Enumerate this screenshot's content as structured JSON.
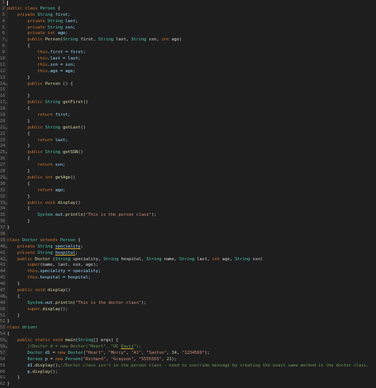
{
  "editor": {
    "lines": [
      [
        {
          "t": "",
          "c": "pl"
        }
      ],
      [
        {
          "t": "public class ",
          "c": "kw"
        },
        {
          "t": "Person",
          "c": "cls"
        },
        {
          "t": " {",
          "c": "pl"
        }
      ],
      [
        {
          "t": "    private ",
          "c": "kw"
        },
        {
          "t": "String ",
          "c": "cls"
        },
        {
          "t": "first;",
          "c": "fld"
        }
      ],
      [
        {
          "t": "        private ",
          "c": "kw"
        },
        {
          "t": "String ",
          "c": "cls"
        },
        {
          "t": "last;",
          "c": "fld"
        }
      ],
      [
        {
          "t": "        private ",
          "c": "kw"
        },
        {
          "t": "String ",
          "c": "cls"
        },
        {
          "t": "ssn;",
          "c": "fld"
        }
      ],
      [
        {
          "t": "        private ",
          "c": "kw"
        },
        {
          "t": "int ",
          "c": "kw"
        },
        {
          "t": "age;",
          "c": "fld"
        }
      ],
      [
        {
          "t": "        public ",
          "c": "kw"
        },
        {
          "t": "Person",
          "c": "mth"
        },
        {
          "t": "(",
          "c": "pl"
        },
        {
          "t": "String ",
          "c": "cls"
        },
        {
          "t": "first, ",
          "c": "pl"
        },
        {
          "t": "String ",
          "c": "cls"
        },
        {
          "t": "last, ",
          "c": "pl"
        },
        {
          "t": "String ",
          "c": "cls"
        },
        {
          "t": "ssn, ",
          "c": "pl"
        },
        {
          "t": "int ",
          "c": "kw"
        },
        {
          "t": "age)",
          "c": "pl"
        }
      ],
      [
        {
          "t": "        {",
          "c": "pl"
        }
      ],
      [
        {
          "t": "            this",
          "c": "kw"
        },
        {
          "t": ".first = first;",
          "c": "fld"
        }
      ],
      [
        {
          "t": "            this",
          "c": "kw"
        },
        {
          "t": ".last = last;",
          "c": "fld"
        }
      ],
      [
        {
          "t": "            this",
          "c": "kw"
        },
        {
          "t": ".ssn = ssn;",
          "c": "fld"
        }
      ],
      [
        {
          "t": "            this",
          "c": "kw"
        },
        {
          "t": ".age = age;",
          "c": "fld"
        }
      ],
      [
        {
          "t": "        }",
          "c": "pl"
        }
      ],
      [
        {
          "t": "        public ",
          "c": "kw"
        },
        {
          "t": "Person",
          "c": "mth"
        },
        {
          "t": " () {",
          "c": "pl"
        }
      ],
      [
        {
          "t": "",
          "c": "pl"
        }
      ],
      [
        {
          "t": "        }",
          "c": "pl"
        }
      ],
      [
        {
          "t": "        public ",
          "c": "kw"
        },
        {
          "t": "String ",
          "c": "cls"
        },
        {
          "t": "getFirst",
          "c": "mth"
        },
        {
          "t": "()",
          "c": "pl"
        }
      ],
      [
        {
          "t": "        {",
          "c": "pl"
        }
      ],
      [
        {
          "t": "            return ",
          "c": "kw"
        },
        {
          "t": "first;",
          "c": "fld"
        }
      ],
      [
        {
          "t": "        }",
          "c": "pl"
        }
      ],
      [
        {
          "t": "        public ",
          "c": "kw"
        },
        {
          "t": "String ",
          "c": "cls"
        },
        {
          "t": "getLast",
          "c": "mth"
        },
        {
          "t": "()",
          "c": "pl"
        }
      ],
      [
        {
          "t": "        {",
          "c": "pl"
        }
      ],
      [
        {
          "t": "            return ",
          "c": "kw"
        },
        {
          "t": "last;",
          "c": "fld"
        }
      ],
      [
        {
          "t": "        }",
          "c": "pl"
        }
      ],
      [
        {
          "t": "        public ",
          "c": "kw"
        },
        {
          "t": "String ",
          "c": "cls"
        },
        {
          "t": "getSSN",
          "c": "mth"
        },
        {
          "t": "()",
          "c": "pl"
        }
      ],
      [
        {
          "t": "        {",
          "c": "pl"
        }
      ],
      [
        {
          "t": "            return ",
          "c": "kw"
        },
        {
          "t": "ssn;",
          "c": "fld"
        }
      ],
      [
        {
          "t": "        }",
          "c": "pl"
        }
      ],
      [
        {
          "t": "        public ",
          "c": "kw"
        },
        {
          "t": "int ",
          "c": "kw"
        },
        {
          "t": "getAge",
          "c": "mth"
        },
        {
          "t": "()",
          "c": "pl"
        }
      ],
      [
        {
          "t": "        {",
          "c": "pl"
        }
      ],
      [
        {
          "t": "            return ",
          "c": "kw"
        },
        {
          "t": "age;",
          "c": "fld"
        }
      ],
      [
        {
          "t": "        }",
          "c": "pl"
        }
      ],
      [
        {
          "t": "        public ",
          "c": "kw"
        },
        {
          "t": "void ",
          "c": "kw"
        },
        {
          "t": "display",
          "c": "mth"
        },
        {
          "t": "()",
          "c": "pl"
        }
      ],
      [
        {
          "t": "        {",
          "c": "pl"
        }
      ],
      [
        {
          "t": "            System.",
          "c": "cls"
        },
        {
          "t": "out",
          "c": "fld"
        },
        {
          "t": ".",
          "c": "pl"
        },
        {
          "t": "println",
          "c": "mth"
        },
        {
          "t": "(",
          "c": "pl"
        },
        {
          "t": "\"This is the person class\"",
          "c": "str"
        },
        {
          "t": ");",
          "c": "pl"
        }
      ],
      [
        {
          "t": "        }",
          "c": "pl"
        }
      ],
      [
        {
          "t": "}",
          "c": "pl"
        }
      ],
      [
        {
          "t": "",
          "c": "pl"
        }
      ],
      [
        {
          "t": "class ",
          "c": "kw"
        },
        {
          "t": "Doctor ",
          "c": "cls"
        },
        {
          "t": "extends ",
          "c": "kw"
        },
        {
          "t": "Person",
          "c": "cls"
        },
        {
          "t": " {",
          "c": "pl"
        }
      ],
      [
        {
          "t": "    private ",
          "c": "kw"
        },
        {
          "t": "String ",
          "c": "cls"
        },
        {
          "t": "speciality",
          "c": "fld",
          "u": true
        },
        {
          "t": ";",
          "c": "pl"
        }
      ],
      [
        {
          "t": "    private ",
          "c": "kw"
        },
        {
          "t": "String ",
          "c": "cls"
        },
        {
          "t": "hospital",
          "c": "fld",
          "u": true
        },
        {
          "t": ";",
          "c": "pl"
        }
      ],
      [
        {
          "t": "    public ",
          "c": "kw"
        },
        {
          "t": "Doctor ",
          "c": "mth"
        },
        {
          "t": "(",
          "c": "pl"
        },
        {
          "t": "String ",
          "c": "cls"
        },
        {
          "t": "speciality, ",
          "c": "pl"
        },
        {
          "t": "String ",
          "c": "cls"
        },
        {
          "t": "hospital, ",
          "c": "pl"
        },
        {
          "t": "String ",
          "c": "cls"
        },
        {
          "t": "name, ",
          "c": "pl"
        },
        {
          "t": "String ",
          "c": "cls"
        },
        {
          "t": "last, ",
          "c": "pl"
        },
        {
          "t": "int ",
          "c": "kw"
        },
        {
          "t": "age, ",
          "c": "pl"
        },
        {
          "t": "String ",
          "c": "cls"
        },
        {
          "t": "ssn)",
          "c": "pl"
        }
      ],
      [
        {
          "t": "        super",
          "c": "kw"
        },
        {
          "t": "(name, last, ssn, age);",
          "c": "pl"
        }
      ],
      [
        {
          "t": "        this",
          "c": "kw"
        },
        {
          "t": ".speciality = speciality;",
          "c": "fld"
        }
      ],
      [
        {
          "t": "        this",
          "c": "kw"
        },
        {
          "t": ".hospital = hospital;",
          "c": "fld"
        }
      ],
      [
        {
          "t": "    }",
          "c": "pl"
        }
      ],
      [
        {
          "t": "    public ",
          "c": "kw"
        },
        {
          "t": "void ",
          "c": "kw"
        },
        {
          "t": "display",
          "c": "mth"
        },
        {
          "t": "()",
          "c": "pl"
        }
      ],
      [
        {
          "t": "    {",
          "c": "pl"
        }
      ],
      [
        {
          "t": "        System.",
          "c": "cls"
        },
        {
          "t": "out",
          "c": "fld"
        },
        {
          "t": ".",
          "c": "pl"
        },
        {
          "t": "println",
          "c": "mth"
        },
        {
          "t": "(",
          "c": "pl"
        },
        {
          "t": "\"This is the doctor class\"",
          "c": "str"
        },
        {
          "t": ");",
          "c": "pl"
        }
      ],
      [
        {
          "t": "        super",
          "c": "kw"
        },
        {
          "t": ".",
          "c": "pl"
        },
        {
          "t": "display",
          "c": "mth"
        },
        {
          "t": "();",
          "c": "pl"
        }
      ],
      [
        {
          "t": "    }",
          "c": "pl"
        }
      ],
      [
        {
          "t": "}",
          "c": "pl"
        }
      ],
      [
        {
          "t": "class ",
          "c": "kw"
        },
        {
          "t": "driver",
          "c": "cls"
        }
      ],
      [
        {
          "t": "{",
          "c": "pl"
        }
      ],
      [
        {
          "t": "    public ",
          "c": "kw"
        },
        {
          "t": "static ",
          "c": "kw"
        },
        {
          "t": "void ",
          "c": "kw"
        },
        {
          "t": "main",
          "c": "mth"
        },
        {
          "t": "(",
          "c": "pl"
        },
        {
          "t": "String",
          "c": "cls"
        },
        {
          "t": "[] args) {",
          "c": "pl"
        }
      ],
      [
        {
          "t": "        //Doctor d = new Doctor(\"Heart\", \"UC ",
          "c": "cm"
        },
        {
          "t": "Davis",
          "c": "cm",
          "u": true
        },
        {
          "t": "\");",
          "c": "cm"
        }
      ],
      [
        {
          "t": "        Doctor ",
          "c": "cls"
        },
        {
          "t": "d1",
          "c": "fld"
        },
        {
          "t": " = ",
          "c": "pl"
        },
        {
          "t": "new ",
          "c": "kw"
        },
        {
          "t": "Doctor",
          "c": "cls"
        },
        {
          "t": "(",
          "c": "pl"
        },
        {
          "t": "\"Heart\"",
          "c": "str"
        },
        {
          "t": ", ",
          "c": "pl"
        },
        {
          "t": "\"Mercy\"",
          "c": "str"
        },
        {
          "t": ", ",
          "c": "pl"
        },
        {
          "t": "\"Al\"",
          "c": "str"
        },
        {
          "t": ", ",
          "c": "pl"
        },
        {
          "t": "\"Santos\"",
          "c": "str"
        },
        {
          "t": ", ",
          "c": "pl"
        },
        {
          "t": "34",
          "c": "num"
        },
        {
          "t": ", ",
          "c": "pl"
        },
        {
          "t": "\"1234566\"",
          "c": "str"
        },
        {
          "t": ");",
          "c": "pl"
        }
      ],
      [
        {
          "t": "        Person ",
          "c": "cls"
        },
        {
          "t": "p",
          "c": "fld"
        },
        {
          "t": " = ",
          "c": "pl"
        },
        {
          "t": "new ",
          "c": "kw"
        },
        {
          "t": "Person",
          "c": "cls"
        },
        {
          "t": "(",
          "c": "pl"
        },
        {
          "t": "\"Richard\"",
          "c": "str"
        },
        {
          "t": ", ",
          "c": "pl"
        },
        {
          "t": "\"Grayson\"",
          "c": "str"
        },
        {
          "t": ", ",
          "c": "pl"
        },
        {
          "t": "\"5555555\"",
          "c": "str"
        },
        {
          "t": ", ",
          "c": "pl"
        },
        {
          "t": "21",
          "c": "num"
        },
        {
          "t": ");",
          "c": "pl"
        }
      ],
      [
        {
          "t": "        d1",
          "c": "fld"
        },
        {
          "t": ".",
          "c": "pl"
        },
        {
          "t": "display",
          "c": "mth"
        },
        {
          "t": "();",
          "c": "pl"
        },
        {
          "t": "//Doctor class isn't in the person class - need to override message by creating the exact same method in the doctor class.",
          "c": "cm"
        }
      ],
      [
        {
          "t": "        p",
          "c": "fld"
        },
        {
          "t": ".",
          "c": "pl"
        },
        {
          "t": "display",
          "c": "mth"
        },
        {
          "t": "();",
          "c": "pl"
        }
      ],
      [
        {
          "t": "    }",
          "c": "pl"
        }
      ],
      [
        {
          "t": "}",
          "c": "pl"
        }
      ]
    ],
    "markers": {
      "7": "⊖",
      "14": "⊖",
      "17": "⊖",
      "21": "⊖",
      "25": "⊖",
      "29": "⊖",
      "33": "⊖",
      "40": "⊖",
      "42": "⊖",
      "48": "⊖",
      "55": "⊖",
      "56": "⊖"
    }
  }
}
